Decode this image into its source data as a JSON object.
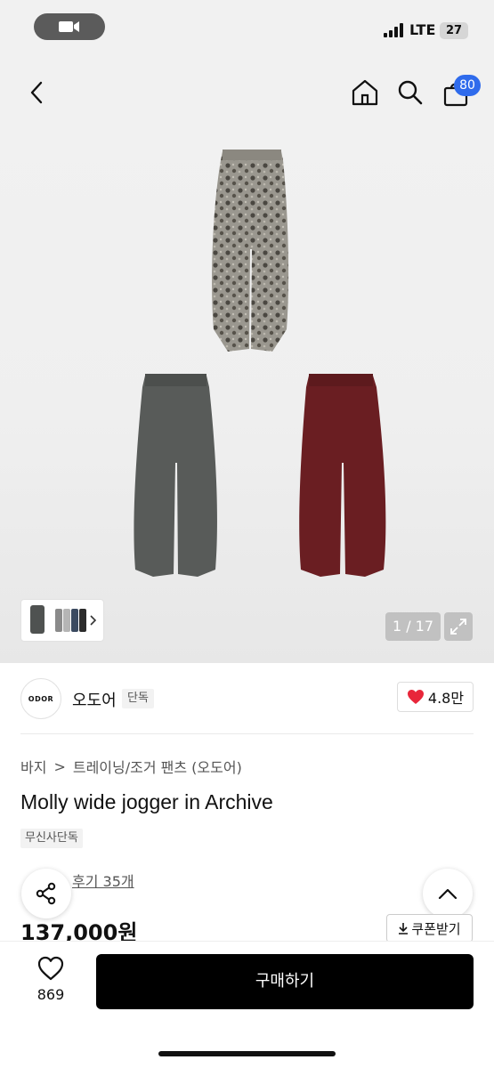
{
  "status_bar": {
    "network": "LTE",
    "battery": "27"
  },
  "header": {
    "cart_count": "80"
  },
  "gallery": {
    "counter": "1 / 17"
  },
  "brand": {
    "logo_text": "ODOR",
    "name": "오도어",
    "badge": "단독",
    "like_count": "4.8만",
    "like_color": "#e8263a"
  },
  "breadcrumb": {
    "items": [
      "바지",
      "트레이닝/조거 팬츠 (오도어)"
    ],
    "separator": ">"
  },
  "product": {
    "title": "Molly wide jogger in Archive",
    "tag": "무신사단독",
    "review_text": "후기 35개",
    "price": "137,000원",
    "coupon_label": "쿠폰받기"
  },
  "bottom_bar": {
    "wish_count": "869",
    "buy_label": "구매하기"
  },
  "colors": {
    "accent": "#2f6bec",
    "buy_button": "#000000"
  },
  "icons": [
    "back-icon",
    "home-icon",
    "search-icon",
    "cart-icon",
    "expand-icon",
    "share-icon",
    "chevron-up-icon",
    "heart-icon",
    "download-icon"
  ]
}
